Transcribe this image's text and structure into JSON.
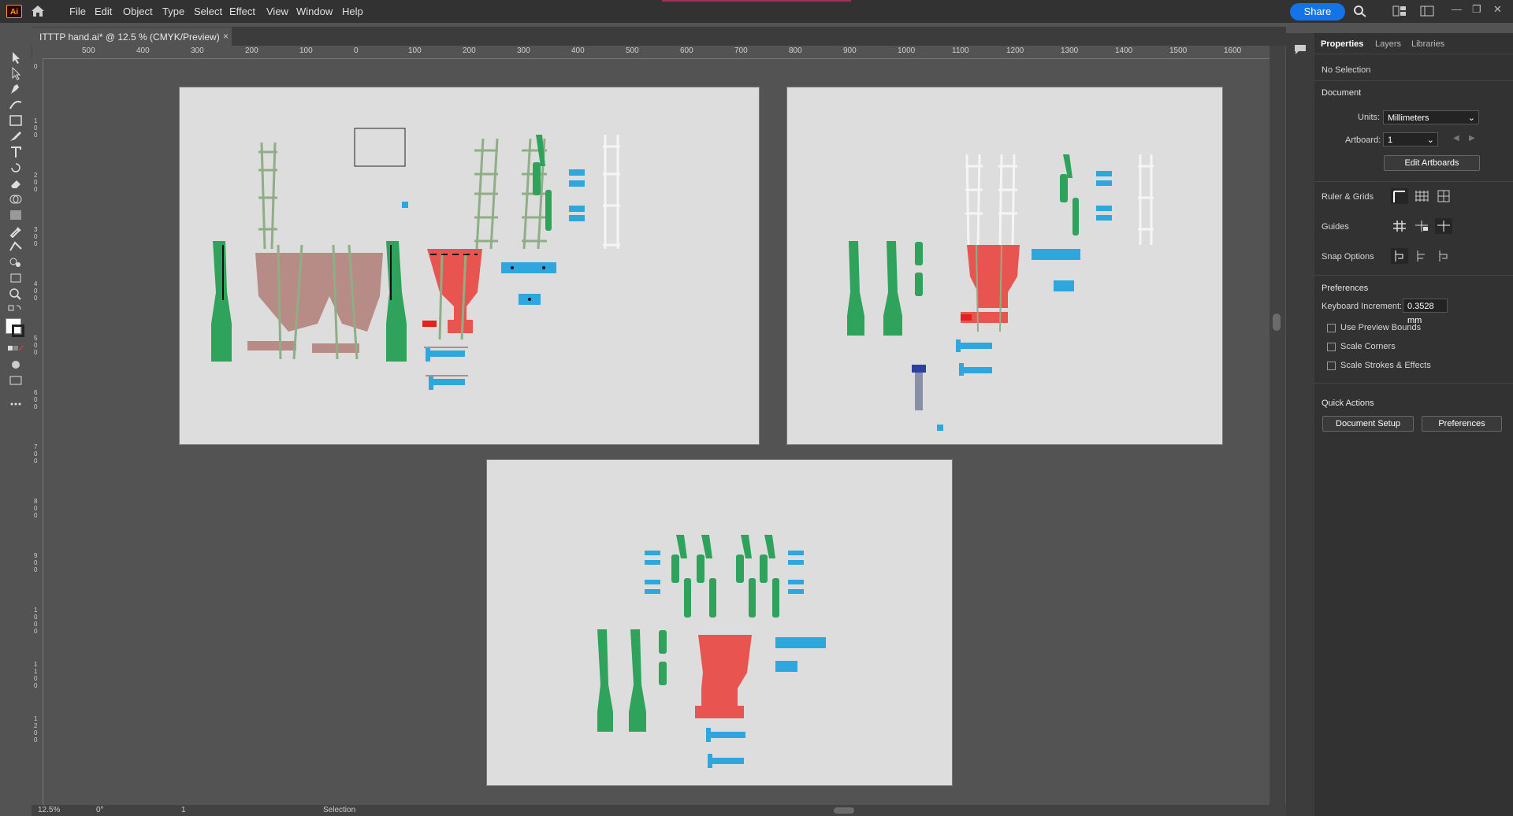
{
  "app": {
    "logo": "Ai",
    "home_icon": "home-icon"
  },
  "menu": [
    "File",
    "Edit",
    "Object",
    "Type",
    "Select",
    "Effect",
    "View",
    "Window",
    "Help"
  ],
  "topbar": {
    "share_label": "Share",
    "icons": [
      "search-icon",
      "arrange-documents-icon",
      "workspace-icon"
    ],
    "window_controls": [
      "—",
      "❐",
      "✕"
    ]
  },
  "document_tab": {
    "title": "ITTTP hand.ai* @ 12.5 % (CMYK/Preview)",
    "close": "×"
  },
  "ruler_top": [
    "500",
    "400",
    "300",
    "200",
    "100",
    "0",
    "100",
    "200",
    "300",
    "400",
    "500",
    "600",
    "700",
    "800",
    "900",
    "1000",
    "1100",
    "1200",
    "1300",
    "1400",
    "1500",
    "1600"
  ],
  "ruler_left": [
    "0",
    "1\n0\n0",
    "2\n0\n0",
    "3\n0\n0",
    "4\n0\n0",
    "5\n0\n0",
    "6\n0\n0",
    "7\n0\n0",
    "8\n0\n0",
    "9\n0\n0",
    "1\n0\n0\n0",
    "1\n1\n0\n0",
    "1\n2\n0\n0"
  ],
  "status": {
    "zoom": "12.5%",
    "rotation": "0°",
    "artboard": "1",
    "tool": "Selection"
  },
  "panel": {
    "tabs": [
      "Properties",
      "Layers",
      "Libraries"
    ],
    "selection": "No Selection",
    "document_header": "Document",
    "units_label": "Units:",
    "units_value": "Millimeters",
    "artboard_label": "Artboard:",
    "artboard_value": "1",
    "edit_artboards": "Edit Artboards",
    "ruler_grids": "Ruler & Grids",
    "guides": "Guides",
    "snap_options": "Snap Options",
    "preferences_header": "Preferences",
    "keyboard_increment_label": "Keyboard Increment:",
    "keyboard_increment_value": "0.3528 mm",
    "use_preview_bounds": "Use Preview Bounds",
    "scale_corners": "Scale Corners",
    "scale_strokes": "Scale Strokes & Effects",
    "quick_actions": "Quick Actions",
    "document_setup": "Document Setup",
    "preferences_button": "Preferences"
  },
  "colors": {
    "green": "#2fa35b",
    "blue": "#2ea7de",
    "red": "#e85450",
    "brown": "#b88c86",
    "sage": "#8fae86",
    "artboard": "#dddddd"
  }
}
